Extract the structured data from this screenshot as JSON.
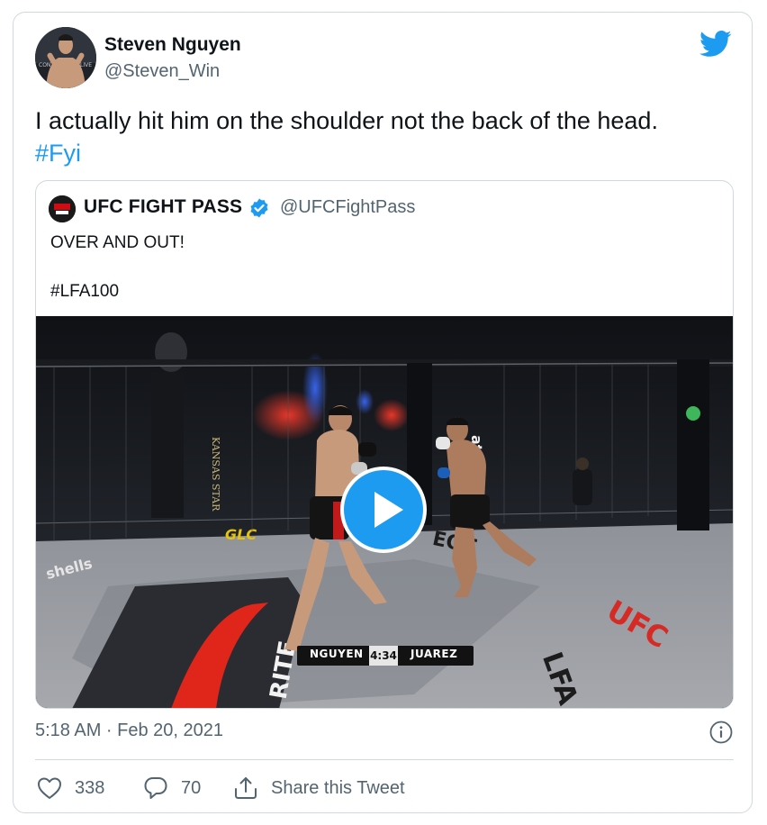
{
  "tweet": {
    "author_name": "Steven Nguyen",
    "author_handle": "@Steven_Win",
    "text": "I actually hit him on the shoulder not the back of the head.",
    "hashtag": "#Fyi",
    "timestamp": "5:18 AM · Feb 20, 2021"
  },
  "quoted_tweet": {
    "author_name": "UFC FIGHT PASS",
    "author_handle": "@UFCFightPass",
    "line1": "OVER AND OUT!",
    "line2": "#LFA100",
    "video": {
      "scoreboard": {
        "left_fighter": "NGUYEN",
        "time": "4:34",
        "right_fighter": "JUAREZ"
      }
    }
  },
  "actions": {
    "likes": "338",
    "replies": "70",
    "share_label": "Share this Tweet"
  },
  "colors": {
    "accent": "#1d9bf0",
    "text": "#0f1419",
    "muted": "#536471",
    "border": "#cfd9de"
  },
  "icons": [
    "twitter-bird-icon",
    "verified-badge-icon",
    "play-icon",
    "info-icon",
    "heart-icon",
    "reply-icon",
    "share-icon"
  ]
}
